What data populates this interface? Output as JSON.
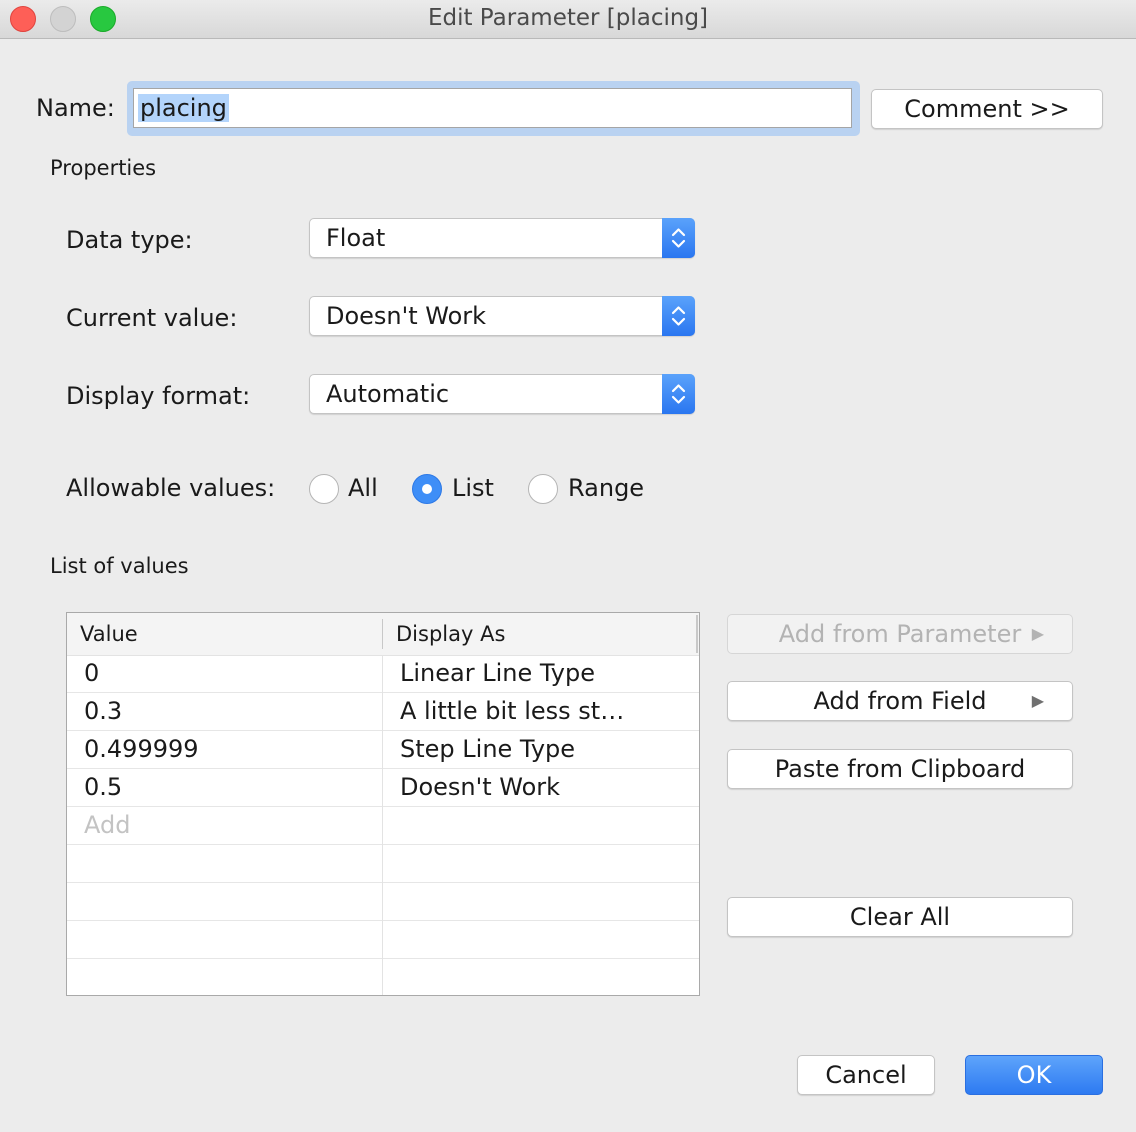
{
  "window": {
    "title": "Edit Parameter [placing]"
  },
  "name": {
    "label": "Name:",
    "value": "placing"
  },
  "comment_button": "Comment >>",
  "properties": {
    "heading": "Properties",
    "data_type": {
      "label": "Data type:",
      "value": "Float"
    },
    "current_value": {
      "label": "Current value:",
      "value": "Doesn't Work"
    },
    "display_format": {
      "label": "Display format:",
      "value": "Automatic"
    },
    "allowable_values": {
      "label": "Allowable values:",
      "options": [
        "All",
        "List",
        "Range"
      ],
      "selected": "List"
    }
  },
  "list_of_values": {
    "heading": "List of values",
    "columns": [
      "Value",
      "Display As"
    ],
    "rows": [
      {
        "value": "0",
        "display": "Linear Line Type"
      },
      {
        "value": "0.3",
        "display": "A little bit less st…"
      },
      {
        "value": "0.499999",
        "display": "Step Line Type"
      },
      {
        "value": "0.5",
        "display": "Doesn't Work"
      }
    ],
    "add_placeholder": "Add"
  },
  "side_buttons": {
    "add_from_parameter": "Add from Parameter",
    "add_from_field": "Add from Field",
    "paste_from_clipboard": "Paste from Clipboard",
    "clear_all": "Clear All"
  },
  "footer": {
    "cancel": "Cancel",
    "ok": "OK"
  },
  "colors": {
    "accent": "#2d7af1",
    "focus_ring": "#b9d2f1",
    "close": "#fe5f57",
    "zoom": "#28c840"
  }
}
